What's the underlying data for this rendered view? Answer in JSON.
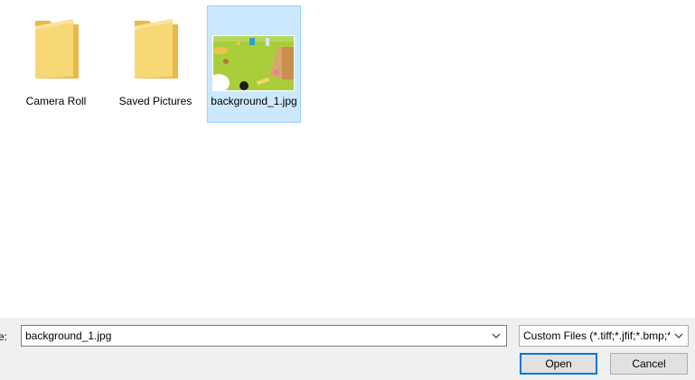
{
  "items": [
    {
      "label": "Camera Roll",
      "icon": "folder-icon",
      "selected": false
    },
    {
      "label": "Saved Pictures",
      "icon": "folder-icon",
      "selected": false
    },
    {
      "label": "background_1.jpg",
      "icon": "image-thumbnail",
      "selected": true
    }
  ],
  "footer": {
    "file_name_label": "me:",
    "file_name_value": "background_1.jpg",
    "file_type": "Custom Files (*.tiff;*.jfif;*.bmp;*",
    "open_label": "Open",
    "cancel_label": "Cancel"
  },
  "colors": {
    "selection_bg": "#cce8ff",
    "selection_border": "#99d1ff",
    "default_button_border": "#0078d7",
    "folder_yellow": "#f8d775",
    "photo_green": "#a8cf3a"
  }
}
